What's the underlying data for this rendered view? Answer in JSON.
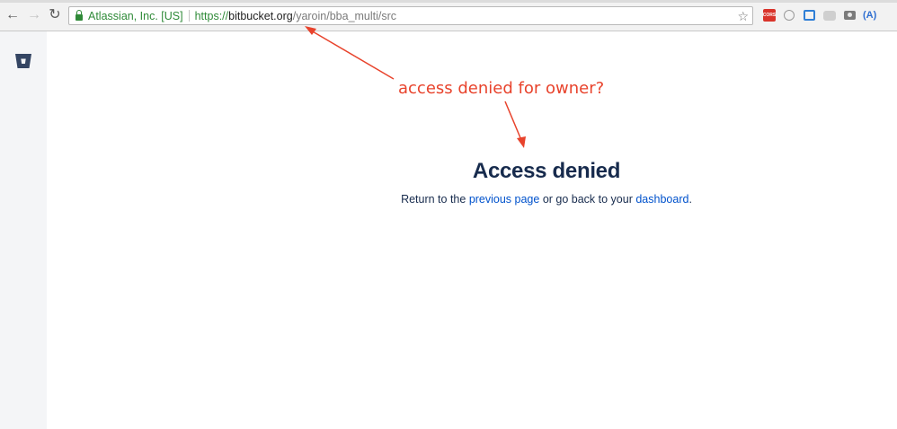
{
  "browser": {
    "ev_name": "Atlassian, Inc. [US]",
    "url_scheme": "https://",
    "url_host": "bitbucket.org",
    "url_path": "/yaroin/bba_multi/src",
    "extensions": [
      "cors-icon",
      "circle-extension-icon",
      "blue-extension-icon",
      "chat-extension-icon",
      "camera-icon",
      "a-extension-icon"
    ],
    "extension_cors_label": "CORS",
    "extension_a_label": "(A)"
  },
  "page": {
    "heading": "Access denied",
    "message_prefix": "Return to the ",
    "previous_page_link": "previous page",
    "message_middle": " or go back to your ",
    "dashboard_link": "dashboard",
    "message_suffix": "."
  },
  "annotation": {
    "text": "access denied for owner?",
    "color": "#e8432c"
  },
  "colors": {
    "heading": "#172b4d",
    "link": "#0052cc",
    "sidebar": "#f4f5f7",
    "secure": "#2f8a38"
  }
}
